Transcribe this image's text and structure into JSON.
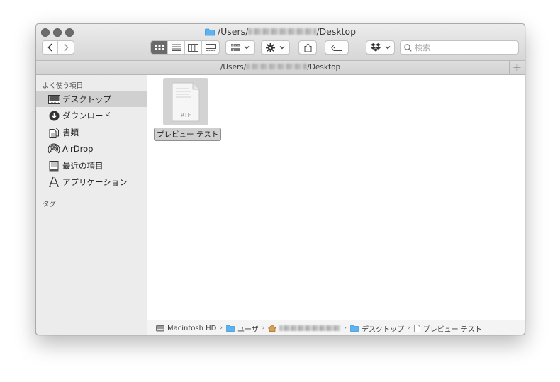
{
  "window": {
    "title_prefix": "/Users/",
    "title_suffix": "/Desktop"
  },
  "toolbar": {
    "search_placeholder": "検索"
  },
  "pathbar": {
    "prefix": "/Users/",
    "suffix": "/Desktop"
  },
  "sidebar": {
    "favorites_heading": "よく使う項目",
    "items": [
      {
        "label": "デスクトップ",
        "icon": "desktop-icon"
      },
      {
        "label": "ダウンロード",
        "icon": "download-icon"
      },
      {
        "label": "書類",
        "icon": "documents-icon"
      },
      {
        "label": "AirDrop",
        "icon": "airdrop-icon"
      },
      {
        "label": "最近の項目",
        "icon": "recents-icon"
      },
      {
        "label": "アプリケーション",
        "icon": "applications-icon"
      }
    ],
    "tags_heading": "タグ"
  },
  "content": {
    "file": {
      "name": "プレビュー テスト",
      "type": "RTF"
    }
  },
  "statusbar": {
    "crumbs": [
      "Macintosh HD",
      "ユーザ",
      "デスクトップ",
      "プレビュー テスト"
    ]
  }
}
